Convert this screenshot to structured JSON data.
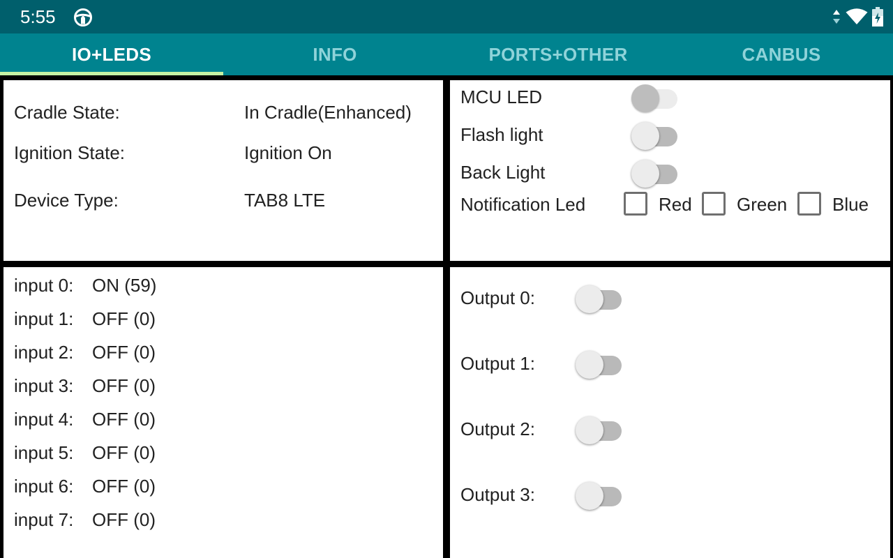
{
  "status_bar": {
    "time": "5:55",
    "icons": [
      "steering-wheel-icon",
      "data-arrows-icon",
      "wifi-icon",
      "battery-charging-icon"
    ]
  },
  "tabs": [
    {
      "label": "IO+LEDS",
      "active": true
    },
    {
      "label": "INFO",
      "active": false
    },
    {
      "label": "PORTS+OTHER",
      "active": false
    },
    {
      "label": "CANBUS",
      "active": false
    }
  ],
  "device_info": {
    "cradle_label": "Cradle State:",
    "cradle_value": "In Cradle(Enhanced)",
    "ignition_label": "Ignition State:",
    "ignition_value": "Ignition On",
    "device_label": "Device Type:",
    "device_value": "TAB8 LTE"
  },
  "leds": {
    "mcu_led_label": "MCU LED",
    "mcu_led_on": false,
    "mcu_led_enabled": false,
    "flash_light_label": "Flash light",
    "flash_light_on": false,
    "back_light_label": "Back Light",
    "back_light_on": false,
    "notification_label": "Notification Led",
    "red_label": "Red",
    "green_label": "Green",
    "blue_label": "Blue"
  },
  "inputs": [
    {
      "label": "input 0:",
      "value": "ON (59)"
    },
    {
      "label": "input 1:",
      "value": "OFF (0)"
    },
    {
      "label": "input 2:",
      "value": "OFF (0)"
    },
    {
      "label": "input 3:",
      "value": "OFF (0)"
    },
    {
      "label": "input 4:",
      "value": "OFF (0)"
    },
    {
      "label": "input 5:",
      "value": "OFF (0)"
    },
    {
      "label": "input 6:",
      "value": "OFF (0)"
    },
    {
      "label": "input 7:",
      "value": "OFF (0)"
    }
  ],
  "outputs": [
    {
      "label": "Output 0:",
      "on": false
    },
    {
      "label": "Output 1:",
      "on": false
    },
    {
      "label": "Output 2:",
      "on": false
    },
    {
      "label": "Output 3:",
      "on": false
    }
  ],
  "colors": {
    "status_bar": "#005f6c",
    "tab_bar": "#00838f",
    "tab_indicator": "#c6f2a4",
    "tab_inactive_text": "#8fd3d9"
  }
}
